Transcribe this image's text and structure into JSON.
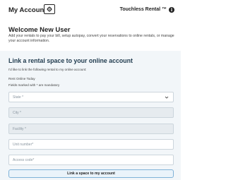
{
  "header": {
    "title": "My Account",
    "settings_icon": "gear-icon",
    "brand": "Touchless Rental ™",
    "info_glyph": "i"
  },
  "welcome": {
    "title": "Welcome New User",
    "description": "Add your rentals to pay your bill, setup autopay, convert your reservations to online rentals, or manage your account information."
  },
  "link_panel": {
    "title": "Link a rental space to your online account",
    "intro": "I'd like to link the following rental to my online account:",
    "rent_label": "Rent Online Today",
    "mandatory_note": "Fields marked with * are mandatory",
    "fields": {
      "state": "State *",
      "city": "City *",
      "facility": "Facility *",
      "unit": "Unit number*",
      "access": "Access code*"
    },
    "submit_label": "Link a space to my account"
  }
}
